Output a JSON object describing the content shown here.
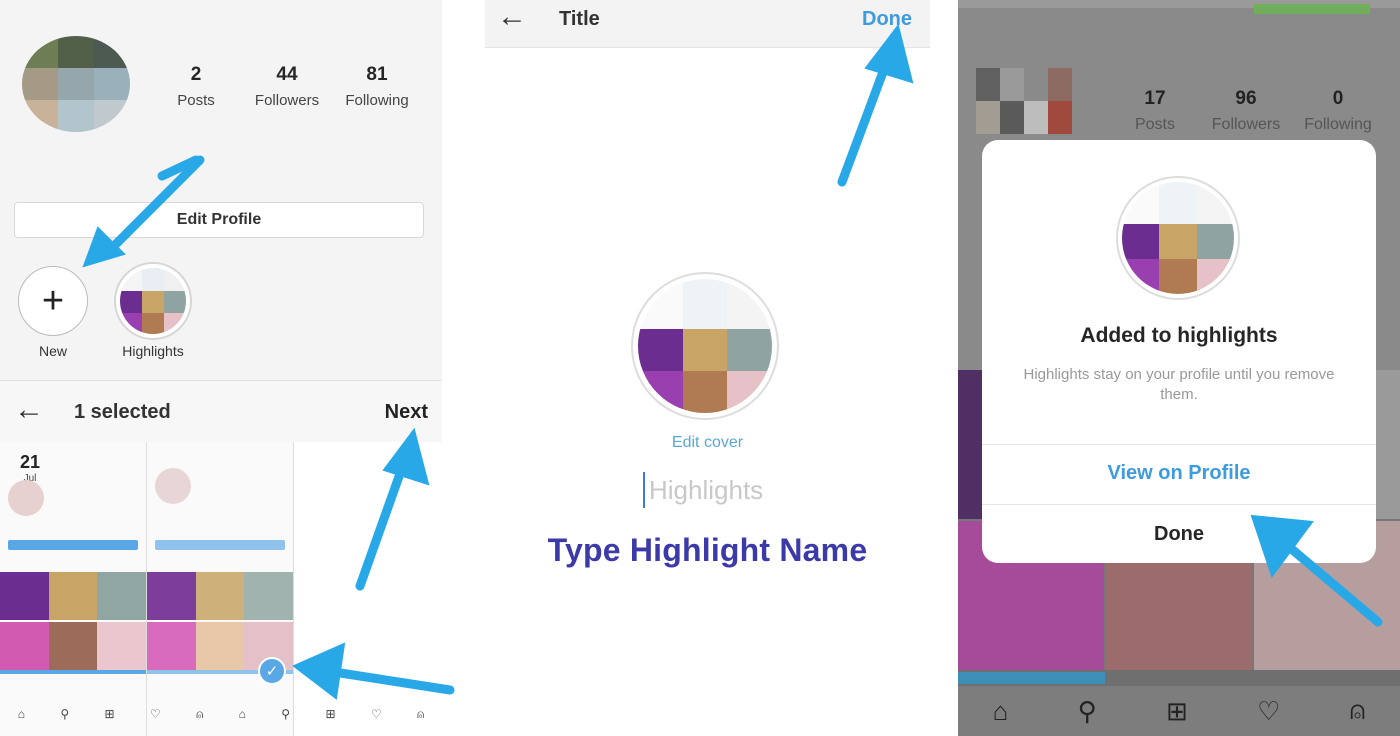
{
  "panel1": {
    "stats": [
      {
        "num": "2",
        "label": "Posts"
      },
      {
        "num": "44",
        "label": "Followers"
      },
      {
        "num": "81",
        "label": "Following"
      }
    ],
    "edit_profile": "Edit Profile",
    "new_label": "New",
    "highlights_label": "Highlights",
    "select_bar": {
      "back": "←",
      "title": "1 selected",
      "next": "Next"
    },
    "story_date": {
      "day": "21",
      "month": "Jul"
    }
  },
  "panel2": {
    "header": {
      "back": "←",
      "title": "Title",
      "done": "Done"
    },
    "edit_cover": "Edit cover",
    "name_placeholder": "Highlights",
    "instruction": "Type Highlight Name"
  },
  "panel3": {
    "stats": [
      {
        "num": "17",
        "label": "Posts"
      },
      {
        "num": "96",
        "label": "Followers"
      },
      {
        "num": "0",
        "label": "Following"
      }
    ],
    "modal": {
      "title": "Added to highlights",
      "text": "Highlights stay on your profile until you remove them.",
      "view_profile": "View on Profile",
      "done": "Done"
    },
    "nav_icons": [
      "home-icon",
      "search-icon",
      "add-icon",
      "heart-icon",
      "profile-icon"
    ]
  },
  "colors": {
    "accent_blue": "#3d9be0",
    "arrow_blue": "#29a8e8",
    "instruction_purple": "#3b3aa8"
  }
}
